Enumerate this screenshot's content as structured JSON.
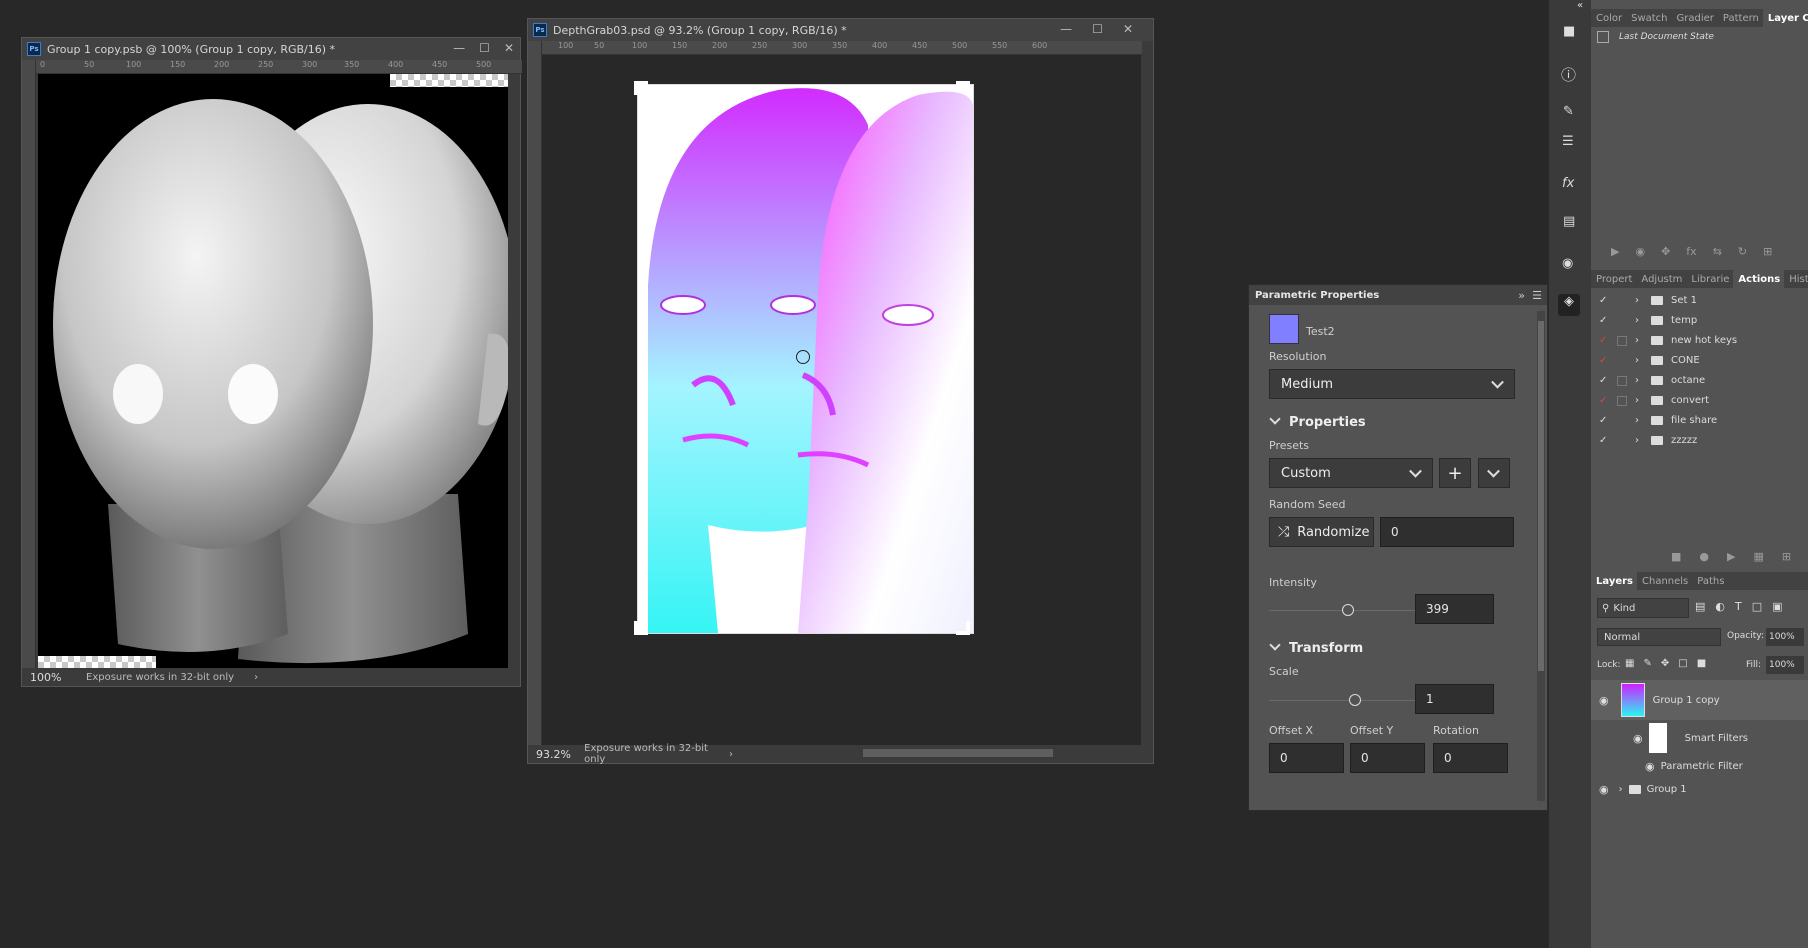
{
  "colors": {
    "accent": "#7f7fff",
    "bg": "#282828",
    "panel": "#535353",
    "red_check": "#e04040"
  },
  "doc1": {
    "title": "Group 1 copy.psb @ 100% (Group 1 copy, RGB/16) *",
    "ruler_ticks": [
      "0",
      "50",
      "100",
      "150",
      "200",
      "250",
      "300",
      "350",
      "400",
      "450",
      "500"
    ],
    "zoom": "100%",
    "status": "Exposure works in 32-bit only"
  },
  "doc2": {
    "title": "DepthGrab03.psd @ 93.2% (Group 1 copy, RGB/16) *",
    "ruler_ticks": [
      "100",
      "50",
      "100",
      "150",
      "200",
      "250",
      "300",
      "350",
      "400",
      "450",
      "500",
      "550",
      "600"
    ],
    "zoom": "93.2%",
    "status": "Exposure works in 32-bit only"
  },
  "parametric": {
    "title": "Parametric Properties",
    "preset_name": "Test2",
    "resolution_label": "Resolution",
    "resolution_value": "Medium",
    "properties_label": "Properties",
    "presets_label": "Presets",
    "presets_value": "Custom",
    "random_seed_label": "Random Seed",
    "randomize_label": "Randomize",
    "seed_value": "0",
    "intensity_label": "Intensity",
    "intensity_value": "399",
    "intensity_fraction": 0.35,
    "transform_label": "Transform",
    "scale_label": "Scale",
    "scale_value": "1",
    "scale_fraction": 0.5,
    "offset_x_label": "Offset X",
    "offset_x_value": "0",
    "offset_y_label": "Offset Y",
    "offset_y_value": "0",
    "rotation_label": "Rotation",
    "rotation_value": "0"
  },
  "top_tabs": [
    "Color",
    "Swatch",
    "Gradier",
    "Pattern",
    "Layer Comp"
  ],
  "layer_comp_item": "Last Document State",
  "mid_tabs": [
    "Propert",
    "Adjustm",
    "Librarie",
    "Actions",
    "Histor"
  ],
  "actions": [
    {
      "name": "Set 1",
      "red": false,
      "box": false
    },
    {
      "name": "temp",
      "red": false,
      "box": false
    },
    {
      "name": "new hot keys",
      "red": true,
      "box": true
    },
    {
      "name": "CONE",
      "red": true,
      "box": false
    },
    {
      "name": "octane",
      "red": false,
      "box": true
    },
    {
      "name": "convert",
      "red": true,
      "box": true
    },
    {
      "name": "file share",
      "red": false,
      "box": false
    },
    {
      "name": "zzzzz",
      "red": false,
      "box": false
    }
  ],
  "layers_tabs": [
    "Layers",
    "Channels",
    "Paths"
  ],
  "layers": {
    "kind": "Kind",
    "blend": "Normal",
    "opacity_label": "Opacity:",
    "opacity": "100%",
    "lock_label": "Lock:",
    "fill_label": "Fill:",
    "fill": "100%",
    "items": [
      "Group 1 copy",
      "Smart Filters",
      "Parametric Filter",
      "Group 1"
    ]
  }
}
